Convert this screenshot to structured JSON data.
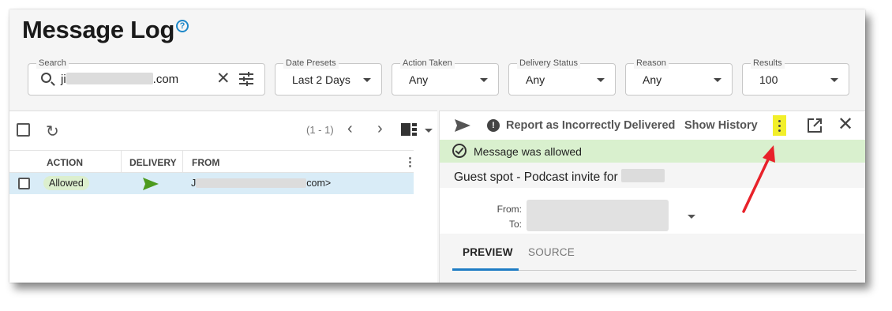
{
  "page": {
    "title": "Message Log",
    "help_icon": "help-circle-icon"
  },
  "filters": {
    "search": {
      "legend": "Search",
      "value_prefix": "ji",
      "value_suffix": ".com",
      "icon": "search-icon"
    },
    "date_presets": {
      "legend": "Date Presets",
      "value": "Last 2 Days"
    },
    "action_taken": {
      "legend": "Action Taken",
      "value": "Any"
    },
    "delivery_status": {
      "legend": "Delivery Status",
      "value": "Any"
    },
    "reason": {
      "legend": "Reason",
      "value": "Any"
    },
    "results": {
      "legend": "Results",
      "value": "100"
    }
  },
  "list": {
    "pager": "(1 - 1)",
    "columns": [
      "ACTION",
      "DELIVERY",
      "FROM"
    ],
    "rows": [
      {
        "action": "Allowed",
        "delivery_icon": "send-icon",
        "from_prefix": "J",
        "from_suffix": "com>"
      }
    ]
  },
  "detail": {
    "report_label": "Report as Incorrectly Delivered",
    "history_label": "Show History",
    "status_text": "Message was allowed",
    "subject": "Guest spot - Podcast invite for",
    "from_label": "From:",
    "to_label": "To:",
    "tabs": [
      {
        "label": "PREVIEW",
        "active": true
      },
      {
        "label": "SOURCE",
        "active": false
      }
    ]
  },
  "colors": {
    "accent_blue": "#1e7cc4",
    "allowed_green": "#d9f0ce",
    "highlight_yellow": "#f2ef2a",
    "arrow_red": "#e8222a",
    "send_green": "#4c9a1e"
  }
}
